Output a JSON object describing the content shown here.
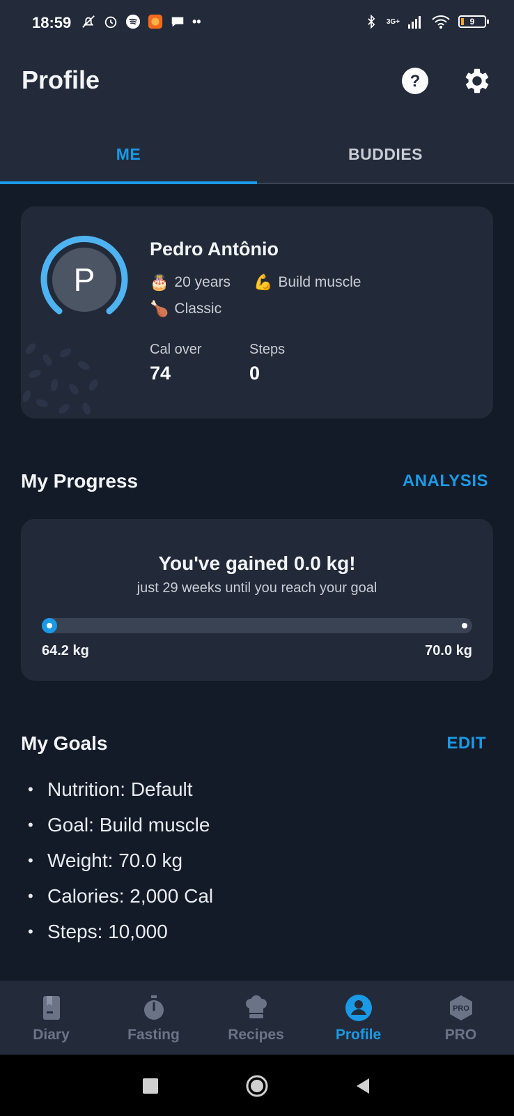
{
  "status_bar": {
    "time": "18:59",
    "network": "3G+",
    "battery": "9"
  },
  "header": {
    "title": "Profile",
    "help_icon": "help-circle-icon",
    "settings_icon": "gear-icon"
  },
  "tabs": [
    {
      "label": "ME",
      "active": true
    },
    {
      "label": "BUDDIES",
      "active": false
    }
  ],
  "profile": {
    "avatar_letter": "P",
    "name": "Pedro Antônio",
    "age": "20 years",
    "goal": "Build muscle",
    "diet": "Classic",
    "stats": [
      {
        "label": "Cal over",
        "value": "74"
      },
      {
        "label": "Steps",
        "value": "0"
      }
    ]
  },
  "progress": {
    "section_title": "My Progress",
    "link": "ANALYSIS",
    "headline": "You've gained 0.0 kg!",
    "subtitle": "just 29 weeks until you reach your goal",
    "start_weight": "64.2 kg",
    "goal_weight": "70.0 kg",
    "fraction": 0
  },
  "goals": {
    "section_title": "My Goals",
    "link": "EDIT",
    "items": [
      "Nutrition: Default",
      "Goal: Build muscle",
      "Weight: 70.0 kg",
      "Calories: 2,000 Cal",
      "Steps: 10,000"
    ]
  },
  "bottom_nav": [
    {
      "label": "Diary",
      "icon": "book-icon",
      "active": false
    },
    {
      "label": "Fasting",
      "icon": "stopwatch-icon",
      "active": false
    },
    {
      "label": "Recipes",
      "icon": "chef-hat-icon",
      "active": false
    },
    {
      "label": "Profile",
      "icon": "user-circle-icon",
      "active": true
    },
    {
      "label": "PRO",
      "icon": "pro-badge-icon",
      "active": false
    }
  ],
  "colors": {
    "accent": "#1a9ae6",
    "background": "#141b28",
    "card": "#222a39",
    "header": "#232b3b"
  }
}
